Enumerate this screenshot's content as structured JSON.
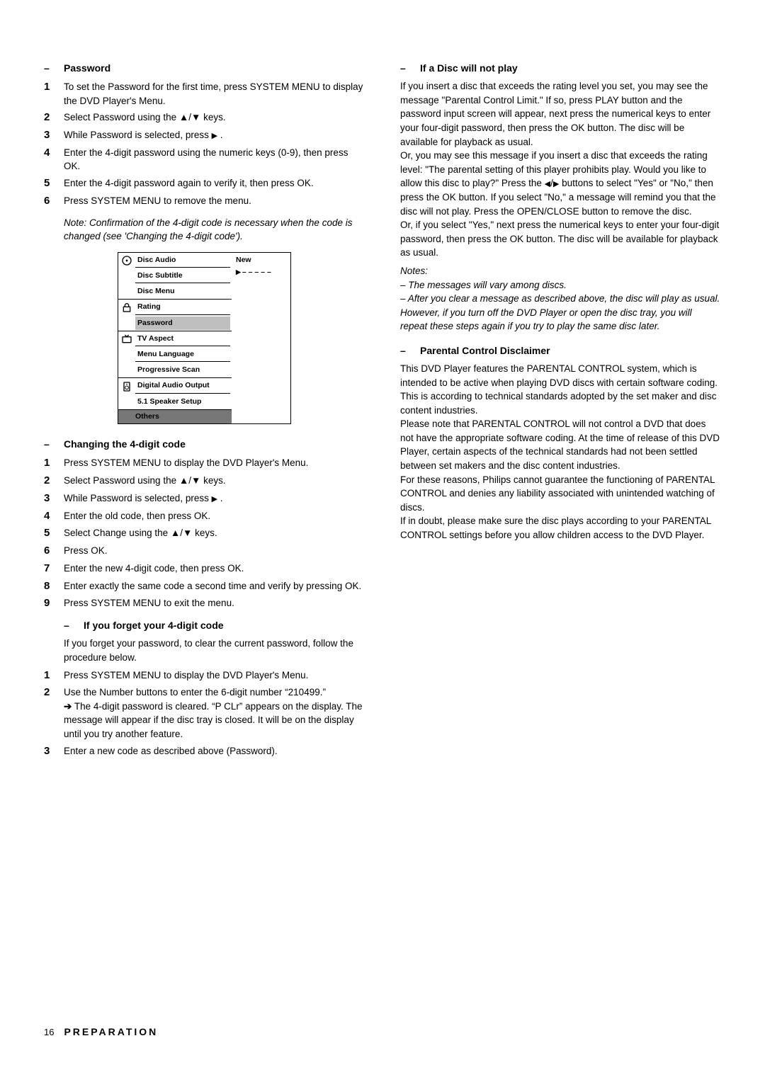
{
  "left": {
    "password": {
      "heading": "Password",
      "steps": {
        "s1": "To set the Password for the first time, press SYSTEM MENU to display the DVD Player's Menu.",
        "s2_pre": "Select Password using the ",
        "s2_post": " keys.",
        "s3_pre": "While Password is selected, press ",
        "s3_post": " .",
        "s4": "Enter the 4-digit password using the numeric keys (0-9), then press OK.",
        "s5": "Enter the 4-digit password again to verify it, then press OK.",
        "s6": "Press SYSTEM MENU to remove the menu."
      },
      "note": "Note: Confirmation of the 4-digit code is necessary when the code is changed (see 'Changing the 4-digit code')."
    },
    "menu": {
      "group1": {
        "icon": "disc-icon",
        "items": [
          "Disc Audio",
          "Disc Subtitle",
          "Disc Menu"
        ]
      },
      "group2": {
        "icon": "lock-icon",
        "items": [
          "Rating",
          "Password"
        ]
      },
      "group3": {
        "icon": "tv-icon",
        "items": [
          "TV Aspect",
          "Menu Language",
          "Progressive Scan"
        ]
      },
      "group4": {
        "icon": "speaker-icon",
        "items": [
          "Digital Audio Output",
          "5.1 Speaker Setup"
        ]
      },
      "others": "Others",
      "right_label": "New",
      "right_value": "– – – – –",
      "highlight": "Password"
    },
    "change": {
      "heading": "Changing the 4-digit code",
      "steps": {
        "s1": "Press SYSTEM MENU to display the DVD Player's Menu.",
        "s2_pre": "Select Password using the ",
        "s2_post": " keys.",
        "s3_pre": "While Password is selected, press ",
        "s3_post": " .",
        "s4": "Enter the old code, then press OK.",
        "s5_pre": "Select Change using the ",
        "s5_post": " keys.",
        "s6": "Press OK.",
        "s7": "Enter the new 4-digit code, then press OK.",
        "s8": "Enter exactly the same code a second time and verify by pressing OK.",
        "s9": "Press SYSTEM MENU to exit the menu."
      }
    },
    "forget": {
      "heading": "If you forget your 4-digit code",
      "intro": "If you forget your password, to clear the current password, follow the procedure below.",
      "steps": {
        "s1": "Press SYSTEM MENU to display the DVD Player's Menu.",
        "s2": "Use the Number buttons to enter the 6-digit number “210499.”",
        "s2_result": "The 4-digit password is cleared. “P CLr” appears on the display. The message will appear if the disc tray is closed. It will be on the display until you try another feature.",
        "s3": "Enter a new code as described above (Password)."
      }
    }
  },
  "right": {
    "notplay": {
      "heading": "If a Disc will not play",
      "p1": "If you insert a disc that exceeds the rating level you set, you may see the message \"Parental Control Limit.\"  If so, press PLAY button and the password input screen will appear, next press the numerical keys to enter your four-digit password, then press the OK button. The disc will be available for playback as usual.",
      "p2_a": "Or, you may see this message if you insert a disc that exceeds the rating level: \"The parental setting of this player prohibits play. Would you like to allow this disc to play?\" Press the ",
      "p2_b": " buttons to select \"Yes\" or \"No,\"  then press the OK button. If you select \"No,\" a message will remind you that the disc will not play. Press the OPEN/CLOSE button to remove the disc.",
      "p3": "Or, if you select \"Yes,\" next press the numerical keys to enter your four-digit password, then press the OK button. The disc will be available for playback as usual.",
      "notes_label": "Notes:",
      "note1": "–  The messages will vary among discs.",
      "note2": "–  After you clear a message as described above, the disc will play as usual. However, if you turn off the DVD Player or open the disc tray, you will repeat these steps again if you try to play the same disc later."
    },
    "disclaimer": {
      "heading": "Parental Control Disclaimer",
      "p1": "This DVD Player features the PARENTAL CONTROL system, which is intended to be active when playing DVD discs with certain software coding. This is according to technical standards adopted by the set maker and disc content industries.",
      "p2": "Please note that PARENTAL CONTROL will not control a DVD that does not have the appropriate software coding. At the time of release of this DVD Player, certain aspects of the technical standards had not been settled between set makers and the disc content industries.",
      "p3": "For these reasons, Philips cannot guarantee the functioning of PARENTAL CONTROL and denies any liability associated with unintended watching of discs.",
      "p4": "If in doubt, please make sure the disc plays according to your PARENTAL CONTROL settings before you allow children access to the DVD Player."
    }
  },
  "footer": {
    "page": "16",
    "crumb": "PREPARATION"
  }
}
